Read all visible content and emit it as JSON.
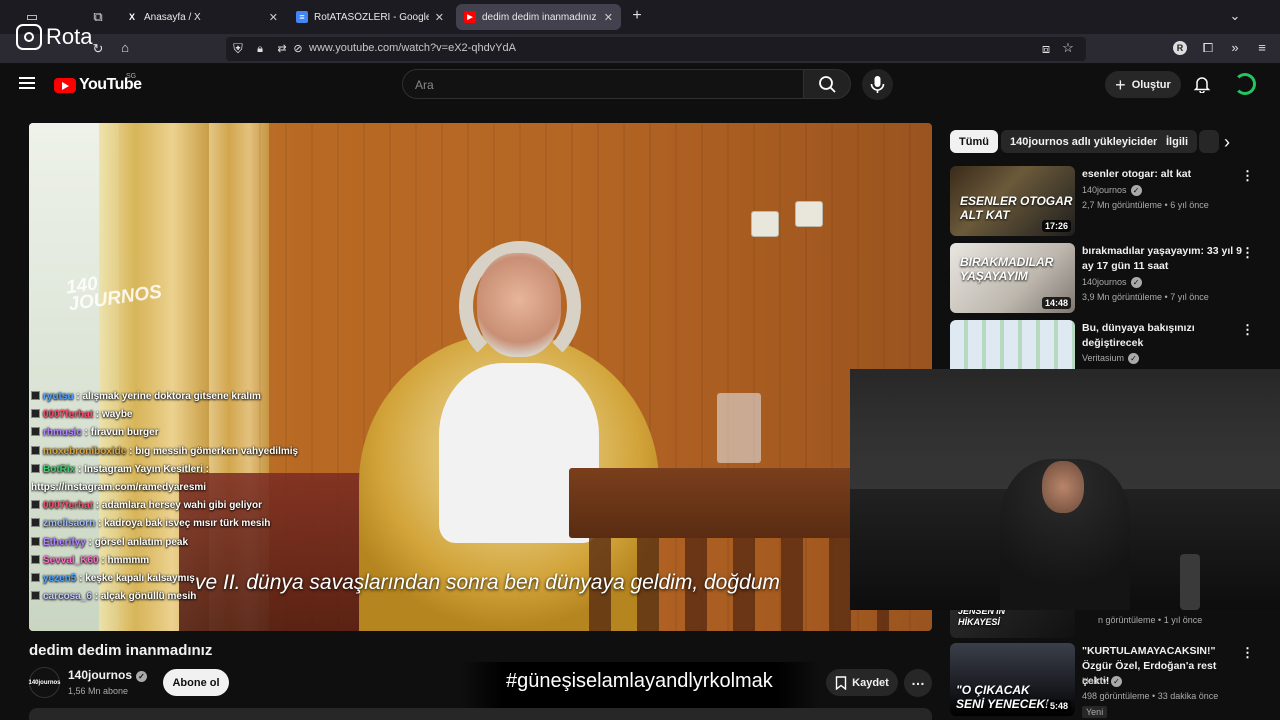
{
  "browser": {
    "tabs": [
      {
        "title": "Anasayfa / X",
        "icon_text": "X",
        "icon_color": "#000000",
        "active": false
      },
      {
        "title": "RotATASÖZLERİ - Google Doküm",
        "icon_text": "≡",
        "icon_color": "#4285f4",
        "active": false
      },
      {
        "title": "dedim dedim inanmadınız - YouT",
        "icon_text": "▶",
        "icon_color": "#ff0000",
        "active": true
      }
    ],
    "url": "www.youtube.com/watch?v=eX2-qhdvYdA",
    "overlay_logo": "Rota"
  },
  "youtube": {
    "logo_text": "YouTube",
    "country_code": "SG",
    "search_placeholder": "Ara",
    "create_label": "Oluştur"
  },
  "video": {
    "watermark": "140\nJOURNOS",
    "subtitle": "ve II. dünya savaşlarından sonra ben dünyaya geldim, doğdum",
    "title": "dedim dedim inanmadınız",
    "channel": "140journos",
    "channel_avatar_text": "140journos",
    "subscribers": "1,56 Mn abone",
    "subscribe_label": "Abone ol",
    "save_label": "Kaydet",
    "hashtag": "#güneşiselamlayandlyrkolmak"
  },
  "chat": [
    {
      "user": "ryutsu",
      "text": "alışmak yerine doktora gitsene kralım",
      "color": "#4fa3ff"
    },
    {
      "user": "0007ferhat",
      "text": "waybe",
      "color": "#ff4d6d"
    },
    {
      "user": "rhmusic",
      "text": "firavun burger",
      "color": "#b084ff"
    },
    {
      "user": "moxebroniboxide",
      "text": "bıg messih gömerken vahyedilmiş",
      "color": "#d9a43a"
    },
    {
      "user": "BotRix",
      "text": "Instagram Yayın Kesitleri :",
      "color": "#3bd16f"
    },
    {
      "user": "",
      "text": "https://instagram.com/ramedyaresmi",
      "color": "#ffffff"
    },
    {
      "user": "0007ferhat",
      "text": "adamlara hersey wahi gibi geliyor",
      "color": "#ff4d6d"
    },
    {
      "user": "zmelisaorn",
      "text": "kadroya bak isveç mısır türk mesih",
      "color": "#9db8ff"
    },
    {
      "user": "Etherifyy",
      "text": "görsel anlatım peak",
      "color": "#b084ff"
    },
    {
      "user": "Sevval_K60",
      "text": "hmmmm",
      "color": "#ff6ec7"
    },
    {
      "user": "yezen5",
      "text": "keşke kapalı kalsaymış",
      "color": "#4fa3ff"
    },
    {
      "user": "carcosa_6",
      "text": "alçak gönüllü mesih",
      "color": "#c9c9ff"
    }
  ],
  "sidebar": {
    "chips": [
      "Tümü",
      "140journos adlı yükleyiciden",
      "İlgili"
    ],
    "recommendations": [
      {
        "title": "esenler otogar: alt kat",
        "channel": "140journos",
        "meta": "2,7 Mn görüntüleme • 6 yıl önce",
        "duration": "17:26",
        "thumb_text": "ESENLER OTOGAR\nALT KAT",
        "verified": true
      },
      {
        "title": "bırakmadılar yaşayayım: 33 yıl 9 ay 17 gün 11 saat",
        "channel": "140journos",
        "meta": "3,9 Mn görüntüleme • 7 yıl önce",
        "duration": "14:48",
        "thumb_text": "BIRAKMADILAR\nYAŞAYAYIM",
        "verified": true
      },
      {
        "title": "Bu, dünyaya bakışınızı değiştirecek",
        "channel": "Veritasium",
        "meta": "",
        "duration": "",
        "thumb_text": "",
        "verified": true
      },
      {
        "title": "",
        "channel": "",
        "meta": "n görüntüleme • 1 yıl önce",
        "duration": "",
        "thumb_text": "JENSEN'IN\nHİKAYESİ",
        "verified": false
      },
      {
        "title": "\"KURTULAMAYACAKSIN!\" Özgür Özel, Erdoğan'a rest çekti! ...",
        "channel": "Halktv",
        "meta": "498 görüntüleme • 33 dakika önce",
        "duration": "5:48",
        "thumb_text": "\"O ÇIKACAK\nSENİ YENECEK!",
        "verified": true,
        "badge": "Yeni"
      }
    ]
  }
}
